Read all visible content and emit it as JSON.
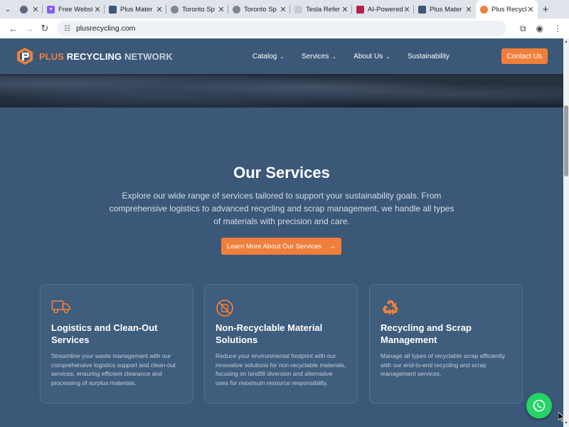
{
  "browser": {
    "tabs": [
      {
        "title": "",
        "icon": "globe-icon"
      },
      {
        "title": "Free Websi",
        "icon": "ai-sparkle-icon"
      },
      {
        "title": "Plus Mater",
        "icon": "site-icon"
      },
      {
        "title": "Toronto Sp",
        "icon": "globe-icon"
      },
      {
        "title": "Toronto Sp",
        "icon": "globe-icon"
      },
      {
        "title": "Tesla Refer",
        "icon": "site-icon"
      },
      {
        "title": "AI-Powered",
        "icon": "ai-icon"
      },
      {
        "title": "Plus Mater",
        "icon": "site-icon"
      },
      {
        "title": "Plus Recycl",
        "icon": "recycling-icon"
      }
    ],
    "address": "plusrecycling.com"
  },
  "header": {
    "logo_word1": "PLUS",
    "logo_word2": "RECYCLING",
    "logo_word3": "NETWORK",
    "nav": [
      {
        "label": "Catalog",
        "dropdown": true
      },
      {
        "label": "Services",
        "dropdown": true
      },
      {
        "label": "About Us",
        "dropdown": true
      },
      {
        "label": "Sustainability",
        "dropdown": false
      }
    ],
    "contact_label": "Contact Us"
  },
  "services": {
    "title": "Our Services",
    "description": "Explore our wide range of services tailored to support your sustainability goals. From comprehensive logistics to advanced recycling and scrap management, we handle all types of materials with precision and care.",
    "button_label": "Learn More About Our Services",
    "cards": [
      {
        "icon": "truck-icon",
        "title": "Logistics and Clean-Out Services",
        "text": "Streamline your waste management with our comprehensive logistics support and clean-out services, ensuring efficient clearance and processing of surplus materials."
      },
      {
        "icon": "no-recycle-icon",
        "title": "Non-Recyclable Material Solutions",
        "text": "Reduce your environmental footprint with our innovative solutions for non-recyclable materials, focusing on landfill diversion and alternative uses for maximum resource responsibility."
      },
      {
        "icon": "recycle-icon",
        "title": "Recycling and Scrap Management",
        "text": "Manage all types of recyclable scrap efficiently with our end-to-end recycling and scrap management services."
      }
    ]
  },
  "colors": {
    "accent": "#f07f3c",
    "page_bg": "#3b5878",
    "whatsapp": "#25d366"
  }
}
